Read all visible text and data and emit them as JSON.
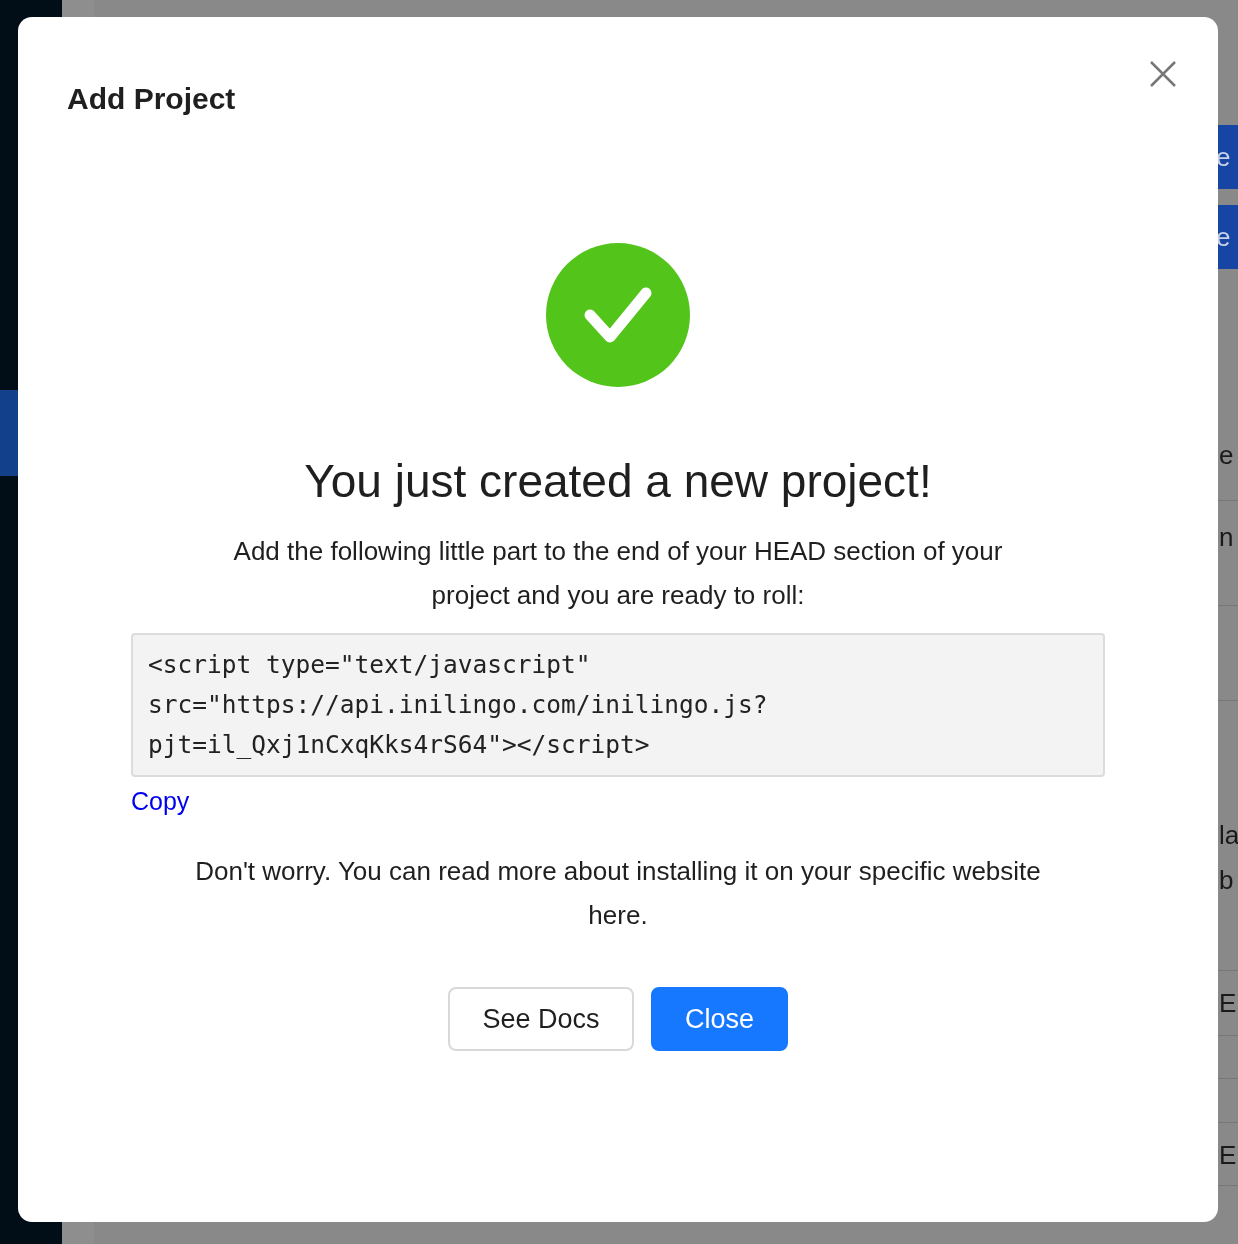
{
  "background": {
    "buttons": [
      "e",
      "e"
    ],
    "fragments": [
      "e",
      "n",
      "la",
      "b",
      "E",
      "E"
    ]
  },
  "dialog": {
    "title": "Add Project",
    "heading": "You just created a new project!",
    "intro": "Add the following little part to the end of your HEAD section of your project and you are ready to roll:",
    "code": "<script type=\"text/javascript\" src=\"https://api.inilingo.com/inilingo.js?pjt=il_Qxj1nCxqKks4rS64\"></script>",
    "copy_link": "Copy",
    "note": "Don't worry. You can read more about installing it on your specific website here.",
    "buttons": [
      {
        "label": "See Docs",
        "kind": "secondary"
      },
      {
        "label": "Close",
        "kind": "primary"
      }
    ]
  }
}
